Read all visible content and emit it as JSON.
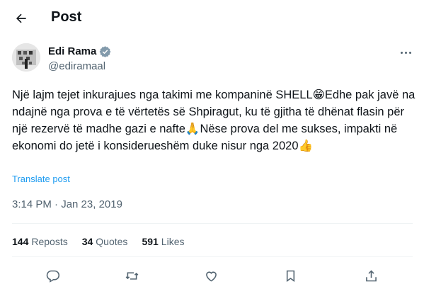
{
  "header": {
    "title": "Post"
  },
  "author": {
    "name": "Edi Rama",
    "handle": "@ediramaal"
  },
  "tweet": {
    "text": "Një lajm tejet inkurajues nga takimi me kompaninë SHELL😁Edhe pak javë na ndajnë nga prova e të vërtetës së Shpiragut, ku të gjitha të dhënat flasin për një rezervë të madhe gazi e nafte🙏Nëse prova del me sukses, impakti në ekonomi do jetë i konsiderueshëm duke nisur nga 2020👍",
    "translate_label": "Translate post",
    "timestamp": "3:14 PM · Jan 23, 2019"
  },
  "stats": {
    "reposts_count": "144",
    "reposts_label": "Reposts",
    "quotes_count": "34",
    "quotes_label": "Quotes",
    "likes_count": "591",
    "likes_label": "Likes"
  },
  "colors": {
    "link": "#1d9bf0",
    "muted": "#536471",
    "text": "#0f1419"
  },
  "icons": [
    "back-arrow-icon",
    "verified-badge-icon",
    "more-icon",
    "reply-icon",
    "repost-icon",
    "like-icon",
    "bookmark-icon",
    "share-icon"
  ]
}
